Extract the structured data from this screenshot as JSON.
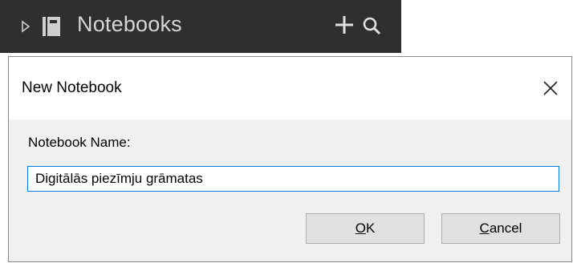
{
  "notebooks_bar": {
    "title": "Notebooks",
    "icons": {
      "expand": "triangle-right-icon",
      "notebook": "notebook-icon",
      "add": "plus-icon",
      "search": "search-icon"
    }
  },
  "dialog": {
    "title": "New Notebook",
    "close_icon": "close-icon",
    "name_label": "Notebook Name:",
    "name_value": "Digitālās piezīmju grāmatas",
    "ok_mnemonic": "O",
    "ok_rest": "K",
    "cancel_mnemonic": "C",
    "cancel_rest": "ancel"
  },
  "colors": {
    "topbar_bg": "#2f2f2f",
    "dialog_bg": "#f0f0f0",
    "input_focus_border": "#0078d7"
  }
}
